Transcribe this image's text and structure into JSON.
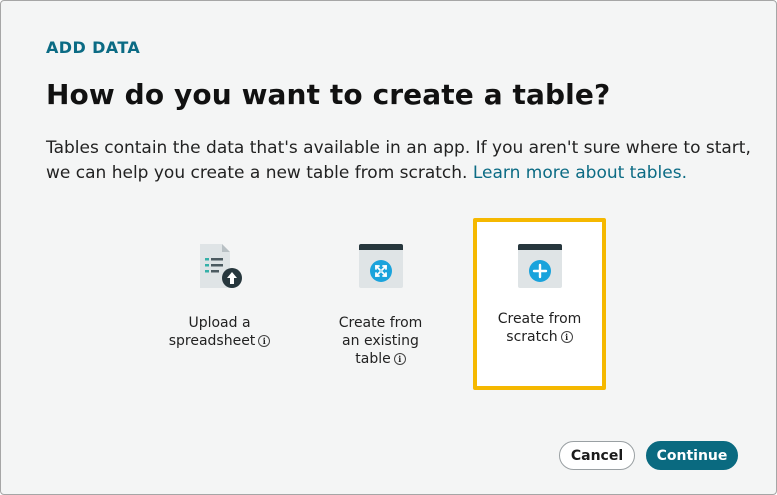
{
  "dialog": {
    "eyebrow": "ADD DATA",
    "title": "How do you want to create a table?",
    "description": "Tables contain the data that's available in an app. If you aren't sure where to start, we can help you create a new table from scratch.",
    "learn_more_link": "Learn more about tables."
  },
  "options": [
    {
      "line1": "Upload a",
      "line2": "spreadsheet",
      "icon": "spreadsheet-upload-icon",
      "selected": false
    },
    {
      "line1": "Create from",
      "line2": "an existing",
      "line3": "table",
      "icon": "table-expand-icon",
      "selected": false
    },
    {
      "line1": "Create from",
      "line2": "scratch",
      "icon": "table-add-icon",
      "selected": true
    }
  ],
  "buttons": {
    "cancel": "Cancel",
    "continue": "Continue"
  },
  "colors": {
    "accent": "#0a6a80",
    "selection_border": "#f5b800",
    "icon_blue": "#1aa3dc"
  }
}
